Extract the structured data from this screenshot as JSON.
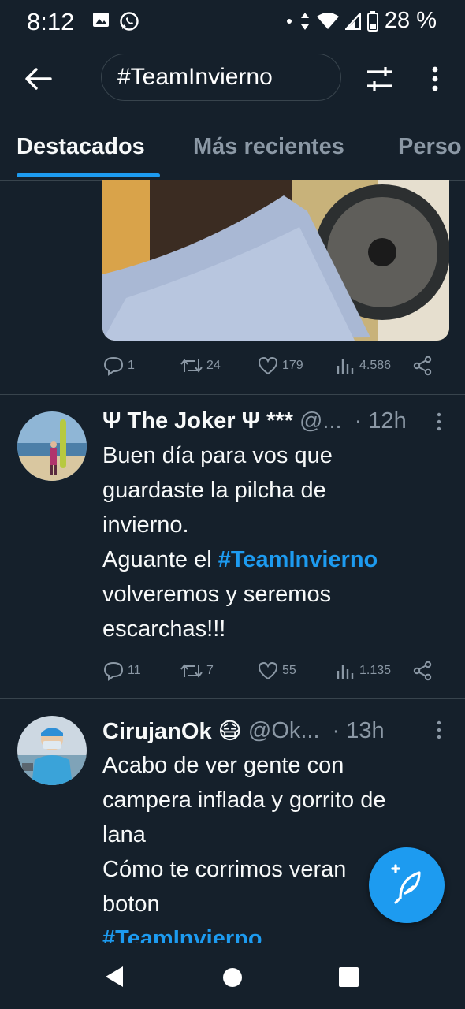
{
  "status_bar": {
    "time": "8:12",
    "battery": "28 %"
  },
  "search": {
    "query": "#TeamInvierno"
  },
  "tabs": [
    "Destacados",
    "Más recientes",
    "Perso"
  ],
  "tweets": [
    {
      "actions": {
        "replies": "1",
        "retweets": "24",
        "likes": "179",
        "views": "4.586"
      }
    },
    {
      "name": "Ψ The Joker Ψ ***",
      "handle": "@...",
      "time": "· 12h",
      "text_lines": [
        "Buen día para vos que",
        "guardaste la pilcha de",
        "invierno.",
        "Aguante el ",
        "volveremos y seremos",
        "escarchas!!!"
      ],
      "hashtag": "#TeamInvierno",
      "actions": {
        "replies": "11",
        "retweets": "7",
        "likes": "55",
        "views": "1.135"
      }
    },
    {
      "name": "CirujanOk 😷",
      "handle": "@Ok...",
      "time": "· 13h",
      "text_lines": [
        "Acabo de ver gente con",
        "campera inflada y gorrito de",
        "lana",
        "Cómo te corrimos veran",
        "boton"
      ],
      "hashtag": "#TeamInvierno"
    }
  ],
  "colors": {
    "background": "#15202b",
    "accent": "#1d9bf0",
    "secondary_text": "#8b98a5",
    "divider": "#38444d"
  }
}
